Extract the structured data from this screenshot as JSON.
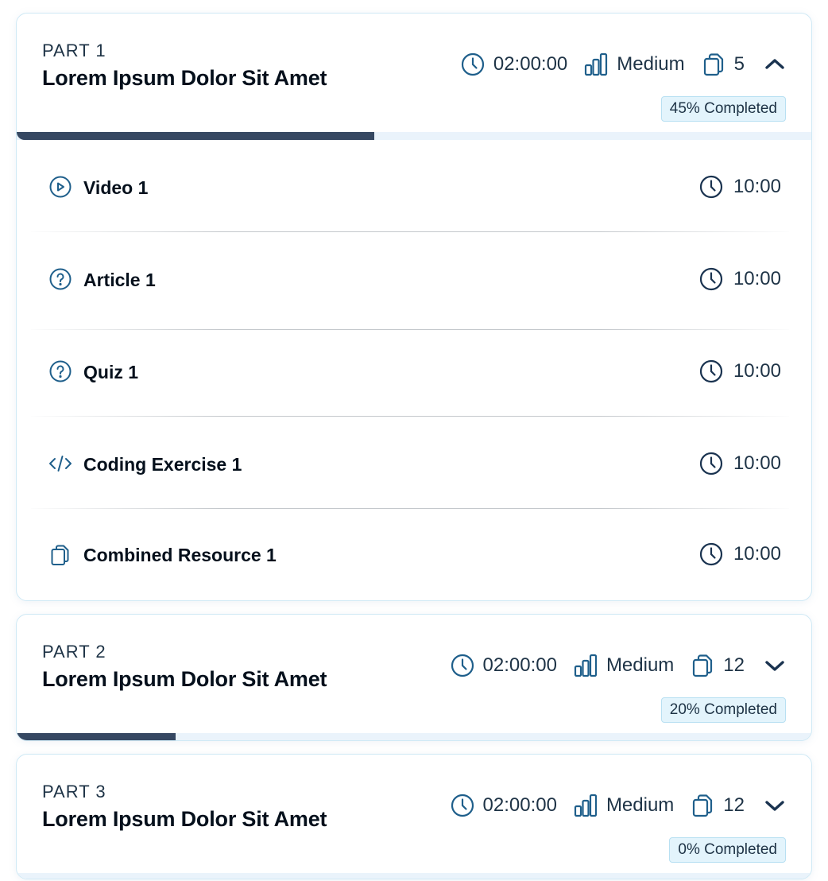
{
  "parts": [
    {
      "label": "PART 1",
      "title": "Lorem Ipsum Dolor Sit Amet",
      "duration": "02:00:00",
      "difficulty": "Medium",
      "resource_count": "5",
      "expanded": true,
      "completed_text": "45% Completed",
      "progress_fraction": 0.45,
      "lessons": [
        {
          "type": "video",
          "icon": "play-circle-icon",
          "name": "Video 1",
          "duration": "10:00"
        },
        {
          "type": "article",
          "icon": "question-circle-icon",
          "name": "Article 1",
          "duration": "10:00"
        },
        {
          "type": "quiz",
          "icon": "question-circle-icon",
          "name": "Quiz 1",
          "duration": "10:00"
        },
        {
          "type": "coding",
          "icon": "code-icon",
          "name": "Coding Exercise 1",
          "duration": "10:00"
        },
        {
          "type": "combined",
          "icon": "copy-icon",
          "name": "Combined Resource 1",
          "duration": "10:00"
        }
      ]
    },
    {
      "label": "PART 2",
      "title": "Lorem Ipsum Dolor Sit Amet",
      "duration": "02:00:00",
      "difficulty": "Medium",
      "resource_count": "12",
      "expanded": false,
      "completed_text": "20% Completed",
      "progress_fraction": 0.2
    },
    {
      "label": "PART 3",
      "title": "Lorem Ipsum Dolor Sit Amet",
      "duration": "02:00:00",
      "difficulty": "Medium",
      "resource_count": "12",
      "expanded": false,
      "completed_text": "0% Completed",
      "progress_fraction": 0
    }
  ],
  "colors": {
    "accent": "#1f5f8b",
    "text_dark": "#05101c",
    "text_meta": "#1e3346",
    "progress_fill": "#364862",
    "progress_track": "#eaf3fb",
    "badge_bg": "#e3f4fc",
    "card_border": "#cfe9f5"
  }
}
